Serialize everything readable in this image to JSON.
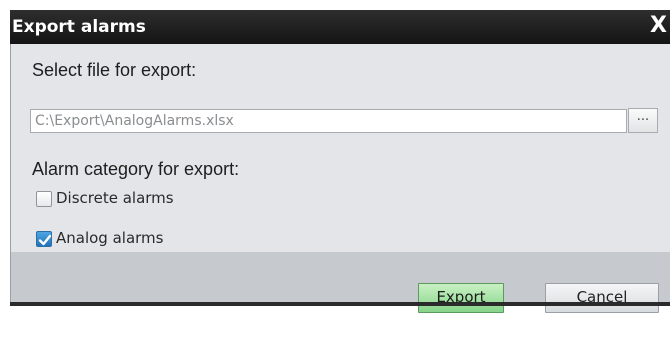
{
  "dialog": {
    "title": "Export alarms",
    "close_glyph": "X",
    "select_file_label": "Select file for export:",
    "file_path": "C:\\Export\\AnalogAlarms.xlsx",
    "browse_label": "...",
    "category_label": "Alarm category for export:",
    "categories": [
      {
        "label": "Discrete alarms",
        "checked": false
      },
      {
        "label": "Analog alarms",
        "checked": true
      }
    ],
    "buttons": {
      "export": "Export",
      "cancel": "Cancel"
    }
  },
  "colors": {
    "titlebar": "#1e1e1e",
    "body": "#e3e5e8",
    "footer": "#c6c9cd",
    "export_button": "#9adf9b",
    "checkbox_checked": "#2f86c9"
  }
}
